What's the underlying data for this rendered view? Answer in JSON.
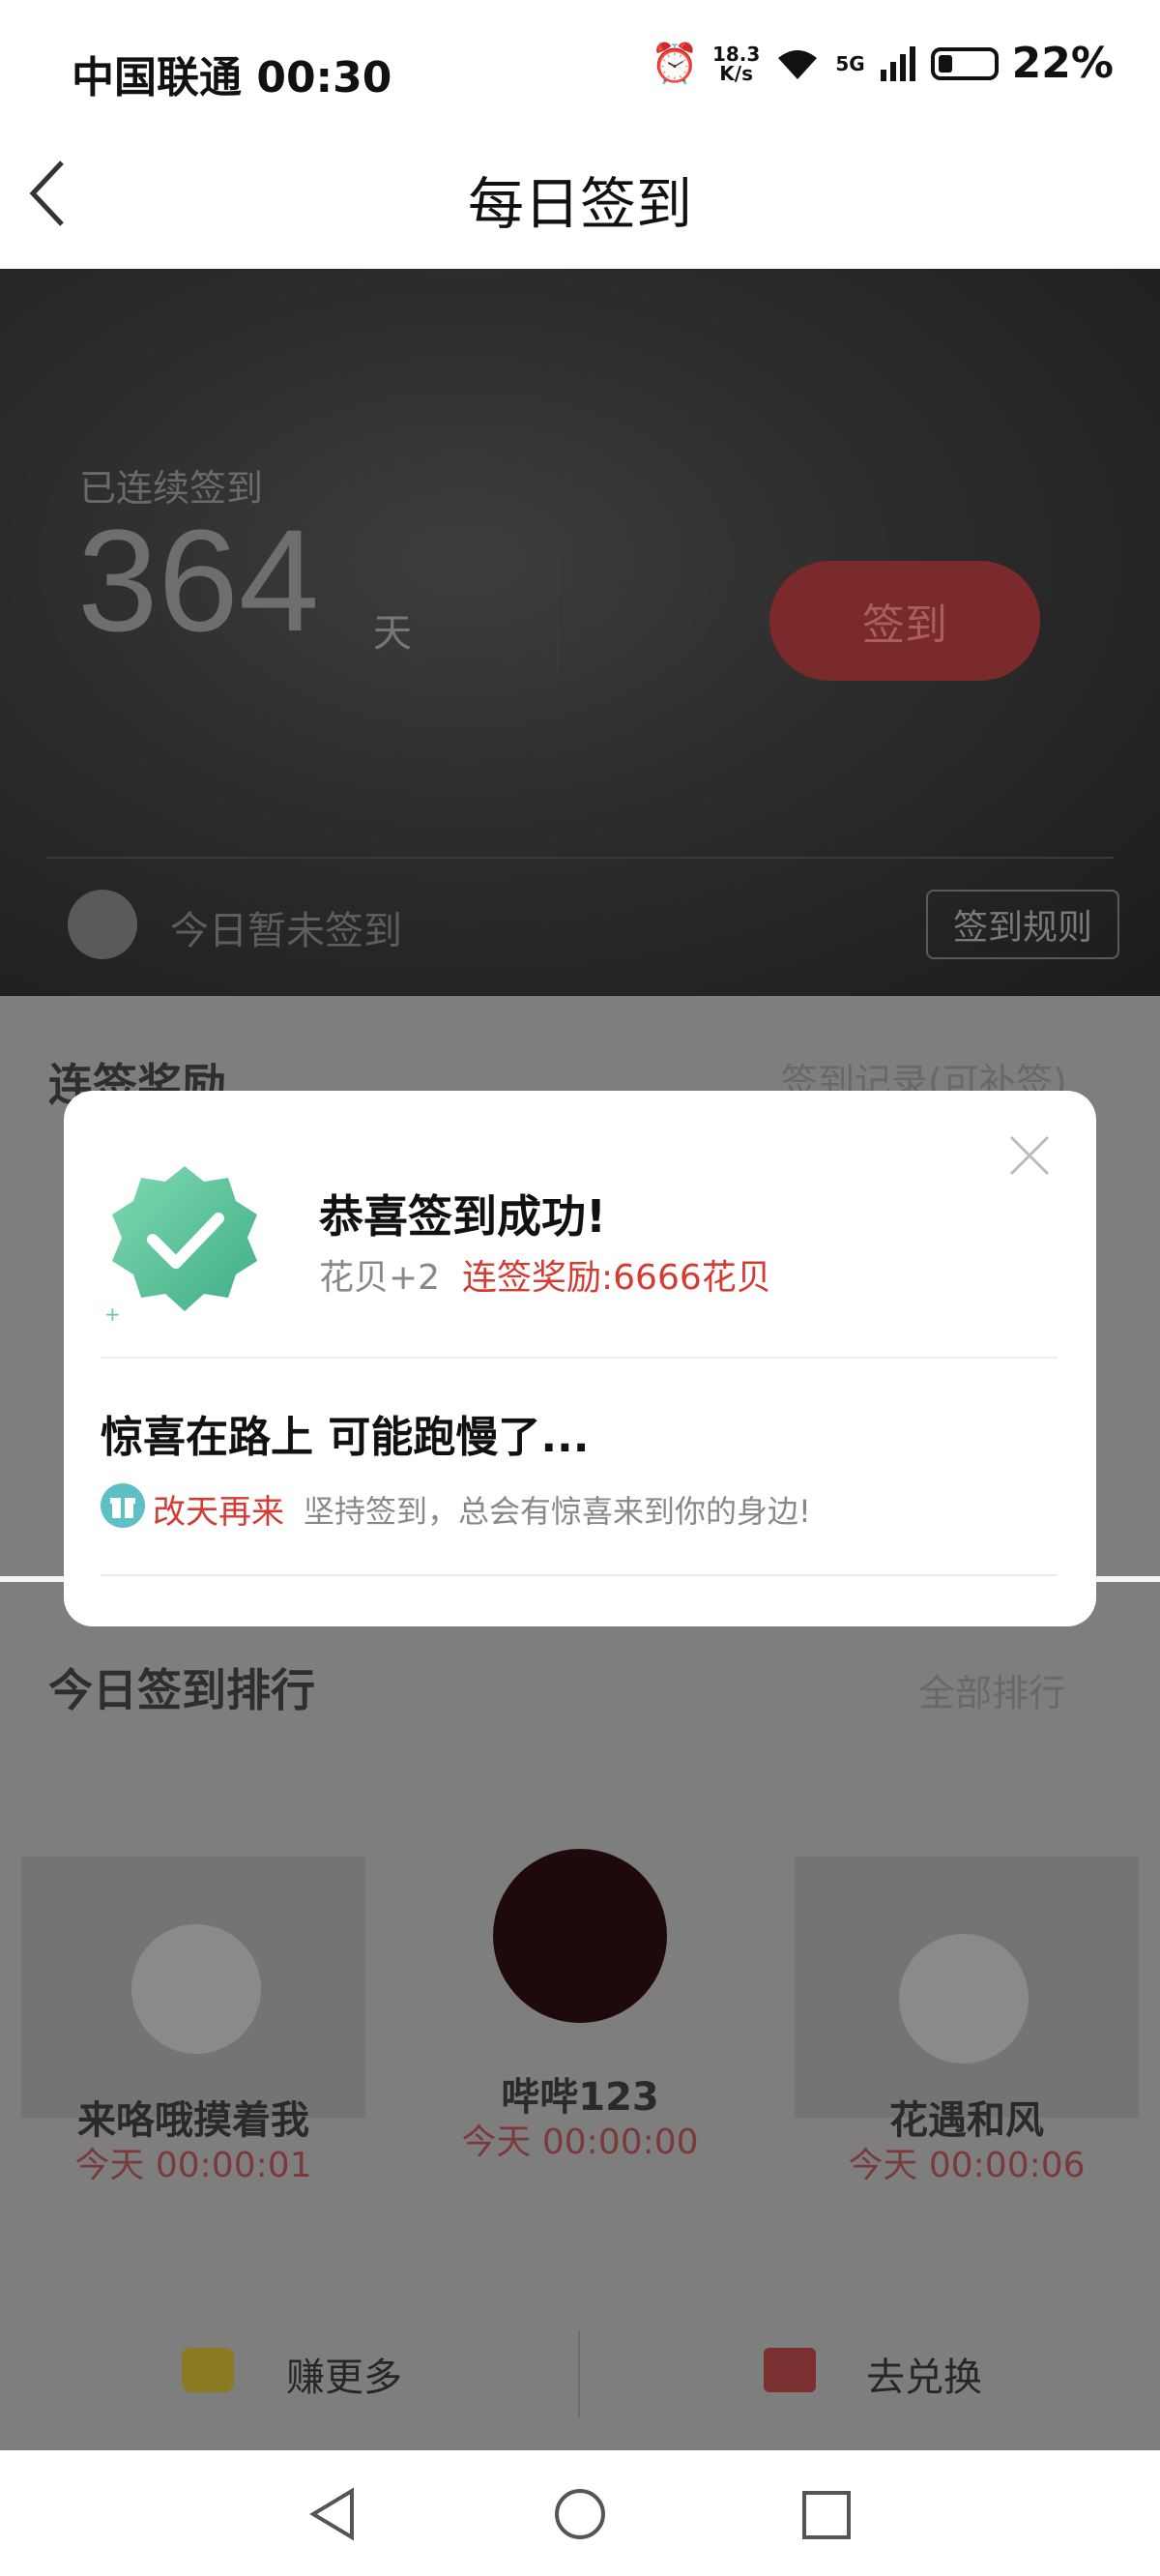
{
  "status_bar": {
    "carrier": "中国联通",
    "time": "00:30",
    "speed_value": "18.3",
    "speed_unit": "K/s",
    "network": "5G",
    "battery": "22%"
  },
  "nav": {
    "title": "每日签到"
  },
  "hero": {
    "streak_label": "已连续签到",
    "streak_days": "364",
    "streak_unit": "天",
    "checkin_button": "签到",
    "today_status": "今日暂未签到",
    "rules_button": "签到规则"
  },
  "section_streak_reward": {
    "title": "连签奖励",
    "link": "签到记录(可补签)"
  },
  "section_ranking": {
    "title": "今日签到排行",
    "link": "全部排行",
    "entries": [
      {
        "name": "来咯哦摸着我",
        "time": "今天 00:00:01"
      },
      {
        "name": "哔哔123",
        "time": "今天 00:00:00"
      },
      {
        "name": "花遇和风",
        "time": "今天 00:00:06"
      }
    ]
  },
  "bottom_actions": {
    "earn": "赚更多",
    "exchange": "去兑换"
  },
  "dialog": {
    "title": "恭喜签到成功!",
    "points": "花贝+2",
    "bonus": "连签奖励:6666花贝",
    "surprise_title": "惊喜在路上 可能跑慢了...",
    "comeback": "改天再来",
    "hint": "坚持签到，总会有惊喜来到你的身边!"
  },
  "colors": {
    "accent_red": "#d33b33",
    "badge_green": "#5cc49a"
  }
}
